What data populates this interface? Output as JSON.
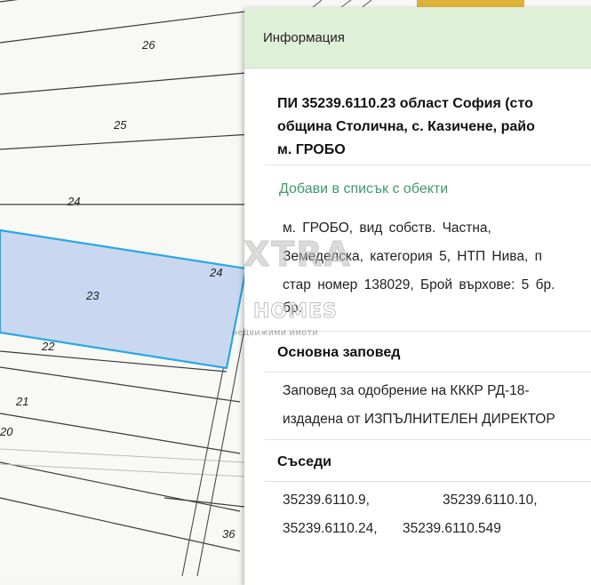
{
  "map": {
    "parcel_labels": [
      "26",
      "25",
      "24",
      "23",
      "22",
      "21",
      "20",
      "24",
      "36"
    ]
  },
  "panel": {
    "header_title": "Информация",
    "title_lines": [
      "ПИ 35239.6110.23 област София (сто",
      "община Столична, с. Казичене, райо",
      "м. ГРОБО"
    ],
    "add_to_list_link": "Добави в списък с обекти",
    "description_lines": [
      "м.  ГРОБО,  вид  собств.  Частна,",
      "Земеделска,  категория  5,  НТП  Нива,  п",
      "стар  номер  138029,  Брой върхове: 5 бр.",
      "бр."
    ],
    "order_section_title": "Основна заповед",
    "order_lines": [
      "Заповед за одобрение на КККР РД-18-",
      "издадена от ИЗПЪЛНИТЕЛЕН ДИРЕКТОР"
    ],
    "neighbors_section_title": "Съседи",
    "neighbors": [
      "35239.6110.9,",
      "35239.6110.10,",
      "35239.6110.24,",
      "35239.6110.549"
    ]
  },
  "watermark": {
    "brand_top": "XTRA",
    "brand_bottom": "HOMES",
    "tagline": "недвижими имоти"
  },
  "colors": {
    "selected_parcel_fill": "#c9d8f0",
    "selected_parcel_stroke": "#2aa8e0",
    "panel_header_bg": "#dff0d8",
    "link_color": "#3c9a6c"
  }
}
